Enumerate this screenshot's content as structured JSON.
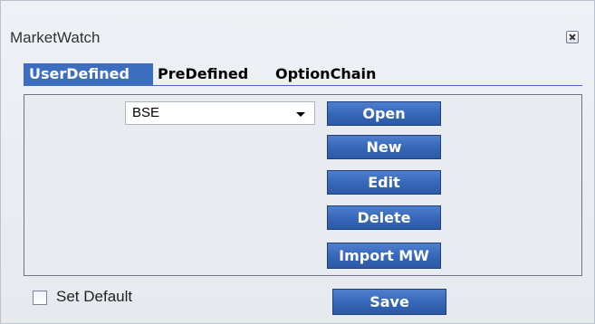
{
  "window": {
    "title": "MarketWatch",
    "close_icon": "close-icon"
  },
  "tabs": [
    {
      "label": "UserDefined",
      "active": true
    },
    {
      "label": "PreDefined",
      "active": false
    },
    {
      "label": "OptionChain",
      "active": false
    }
  ],
  "combo": {
    "value": "BSE",
    "arrow_icon": "chevron-down-icon"
  },
  "buttons": {
    "open": "Open",
    "new": "New",
    "edit": "Edit",
    "delete": "Delete",
    "import": "Import MW",
    "save": "Save"
  },
  "set_default": {
    "label": "Set Default",
    "checked": false
  },
  "colors": {
    "accent": "#3c6dbf",
    "button": "#3566b7"
  }
}
